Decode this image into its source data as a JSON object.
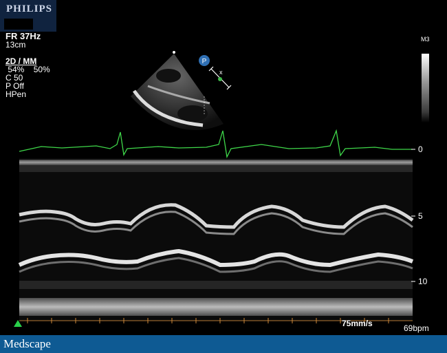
{
  "logo": {
    "brand": "PHILIPS"
  },
  "params": {
    "frame_rate": "FR 37Hz",
    "depth": "13cm",
    "mode": "2D / MM",
    "gain_row": " 54%    50%",
    "compress": "C 50",
    "persistence": "P Off",
    "harmonics": "HPen"
  },
  "probe_marker": "P",
  "grayscale_label": "M3",
  "depth_labels": [
    "0",
    "5",
    "10"
  ],
  "sweep_speed": "75mm/s",
  "heart_rate": "69bpm",
  "colors": {
    "ecg": "#3fd94a",
    "footer": "#0e5a93",
    "marker": "#29d04a"
  },
  "footer": {
    "site": "Medscape"
  }
}
